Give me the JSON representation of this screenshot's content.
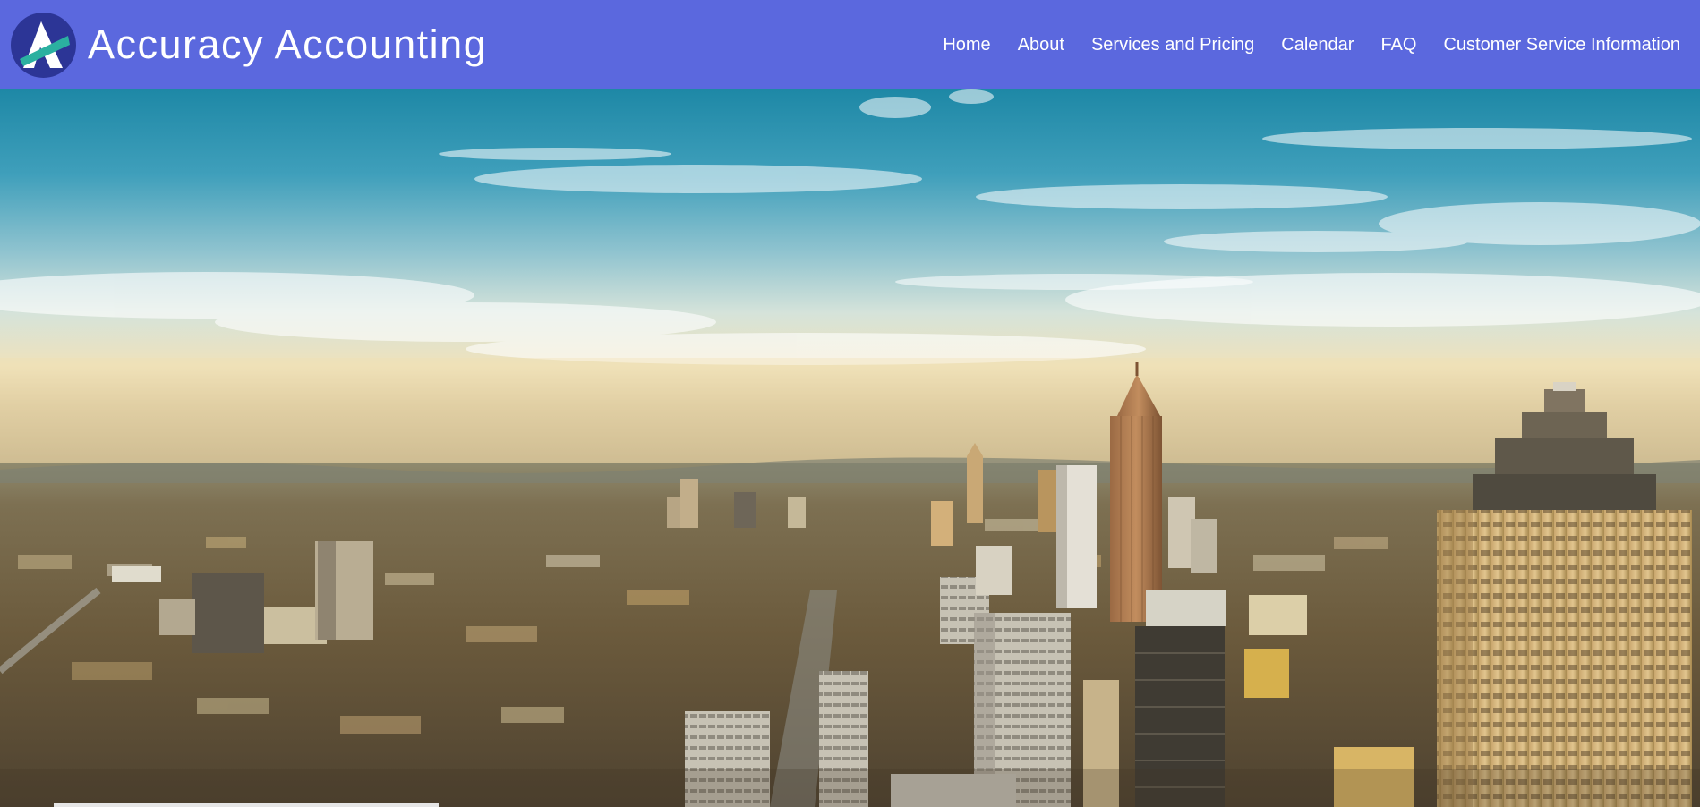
{
  "header": {
    "brand_name": "Accuracy Accounting",
    "logo_icon": "triangle-a-logo-icon",
    "background_color": "#5b68de",
    "text_color": "#ffffff"
  },
  "nav": {
    "items": [
      {
        "label": "Home"
      },
      {
        "label": "About"
      },
      {
        "label": "Services and Pricing"
      },
      {
        "label": "Calendar"
      },
      {
        "label": "FAQ"
      },
      {
        "label": "Customer Service Information"
      }
    ]
  },
  "hero": {
    "image_subject": "city-skyline-photo",
    "sky_colors": [
      "#1f8aa6",
      "#5db3c9",
      "#cfe2de",
      "#f2e2b8"
    ],
    "city_colors": [
      "#6f6244",
      "#8a7752",
      "#c2a06a"
    ]
  }
}
